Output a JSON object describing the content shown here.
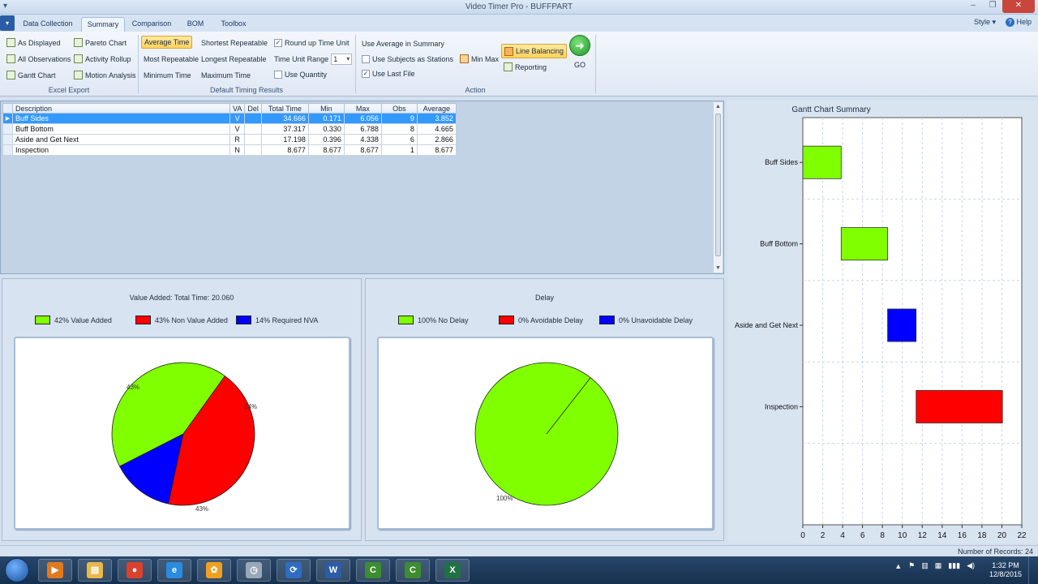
{
  "window": {
    "title": "Video Timer Pro - BUFFPART",
    "qat": "▾",
    "min": "–",
    "max": "❐",
    "close": "✕"
  },
  "tabs": [
    {
      "label": "Data Collection",
      "active": false
    },
    {
      "label": "Summary",
      "active": true
    },
    {
      "label": "Comparison",
      "active": false
    },
    {
      "label": "BOM",
      "active": false
    },
    {
      "label": "Toolbox",
      "active": false
    }
  ],
  "tab_right": {
    "style": "Style ▾",
    "help": "Help",
    "help_glyph": "?"
  },
  "ribbon": {
    "excel_export": {
      "label": "Excel Export",
      "items": [
        "As Displayed",
        "Pareto Chart",
        "All Observations",
        "Activity Rollup",
        "Gantt Chart",
        "Motion Analysis"
      ]
    },
    "default_timing": {
      "label": "Default Timing Results",
      "items": [
        "Average Time",
        "Shortest Repeatable",
        "Most Repeatable",
        "Longest Repeatable",
        "Minimum Time",
        "Maximum Time"
      ],
      "selected": "Average Time"
    },
    "options": {
      "round_up": "Round up Time Unit",
      "round_up_checked": true,
      "time_unit_range": "Time Unit Range",
      "time_unit_value": "1",
      "use_quantity": "Use Quantity",
      "use_quantity_checked": false
    },
    "action": {
      "label": "Action",
      "use_avg": "Use Average in Summary",
      "use_subjects": "Use Subjects as Stations",
      "use_subjects_checked": false,
      "use_last_file": "Use Last File",
      "use_last_file_checked": true,
      "min_max": "Min Max",
      "line_balancing": "Line Balancing",
      "reporting": "Reporting",
      "go": "GO",
      "go_glyph": "➜"
    }
  },
  "grid": {
    "columns": [
      "Description",
      "VA",
      "Del",
      "Total Time",
      "Min",
      "Max",
      "Obs",
      "Average"
    ],
    "rows": [
      [
        "Buff Sides",
        "V",
        "",
        "34.666",
        "0.171",
        "6.056",
        "9",
        "3.852"
      ],
      [
        "Buff Bottom",
        "V",
        "",
        "37.317",
        "0.330",
        "6.788",
        "8",
        "4.665"
      ],
      [
        "Aside and Get Next",
        "R",
        "",
        "17.198",
        "0.396",
        "4.338",
        "6",
        "2.866"
      ],
      [
        "Inspection",
        "N",
        "",
        "8.677",
        "8.677",
        "8.677",
        "1",
        "8.677"
      ]
    ],
    "selected_row": 0,
    "row_marker": "▶",
    "scroll_up": "▲",
    "scroll_down": "▼"
  },
  "value_added_chart": {
    "title": "Value Added: Total Time: 20.060",
    "legend": [
      {
        "label": "42% Value Added",
        "color": "#80ff00"
      },
      {
        "label": "43% Non Value Added",
        "color": "#ff0000"
      },
      {
        "label": "14% Required NVA",
        "color": "#0000ff"
      }
    ],
    "slice_labels": [
      "43%",
      "43%",
      "14%"
    ]
  },
  "delay_chart": {
    "title": "Delay",
    "legend": [
      {
        "label": "100% No Delay",
        "color": "#80ff00"
      },
      {
        "label": "0% Avoidable Delay",
        "color": "#ff0000"
      },
      {
        "label": "0% Unavoidable Delay",
        "color": "#0000ff"
      }
    ],
    "slice_labels": [
      "100%"
    ]
  },
  "chart_data": [
    {
      "type": "pie",
      "title": "Value Added: Total Time: 20.060",
      "labels": [
        "Value Added",
        "Non Value Added",
        "Required NVA"
      ],
      "values": [
        42,
        43,
        14
      ],
      "colors": [
        "#80ff00",
        "#ff0000",
        "#0000ff"
      ]
    },
    {
      "type": "pie",
      "title": "Delay",
      "labels": [
        "No Delay",
        "Avoidable Delay",
        "Unavoidable Delay"
      ],
      "values": [
        100,
        0,
        0
      ],
      "colors": [
        "#80ff00",
        "#ff0000",
        "#0000ff"
      ]
    },
    {
      "type": "bar",
      "title": "Gantt Chart Summary",
      "categories": [
        "Buff Sides",
        "Buff Bottom",
        "Aside and Get Next",
        "Inspection"
      ],
      "start": [
        0,
        3.852,
        8.517,
        11.383
      ],
      "end": [
        3.852,
        8.517,
        11.383,
        20.06
      ],
      "colors": [
        "#80ff00",
        "#80ff00",
        "#0000ff",
        "#ff0000"
      ],
      "xlim": [
        0,
        22
      ],
      "xticks": [
        0,
        2,
        4,
        6,
        8,
        10,
        12,
        14,
        16,
        18,
        20,
        22
      ],
      "grid": true
    }
  ],
  "status": {
    "records": "Number of Records: 24"
  },
  "taskbar": {
    "apps": [
      {
        "name": "media-player",
        "glyph": "▶",
        "color": "#e07a1f"
      },
      {
        "name": "file-explorer",
        "glyph": "▤",
        "color": "#e8b84a"
      },
      {
        "name": "chrome",
        "glyph": "●",
        "color": "#d9412e"
      },
      {
        "name": "internet-explorer",
        "glyph": "e",
        "color": "#2a8be0"
      },
      {
        "name": "flower-app",
        "glyph": "✿",
        "color": "#f0a020"
      },
      {
        "name": "video-timer",
        "glyph": "◷",
        "color": "#9aa7b8"
      },
      {
        "name": "sync-app",
        "glyph": "⟳",
        "color": "#2f6cc2"
      },
      {
        "name": "word",
        "glyph": "W",
        "color": "#2b5ca8"
      },
      {
        "name": "camtasia-1",
        "glyph": "C",
        "color": "#3c8d2f"
      },
      {
        "name": "camtasia-2",
        "glyph": "C",
        "color": "#3c8d2f"
      },
      {
        "name": "excel",
        "glyph": "X",
        "color": "#207245"
      }
    ],
    "tray": [
      "▲",
      "⚑",
      "▥",
      "▦",
      "▮▮▮",
      "◀)"
    ],
    "time": "1:32 PM",
    "date": "12/8/2015"
  }
}
